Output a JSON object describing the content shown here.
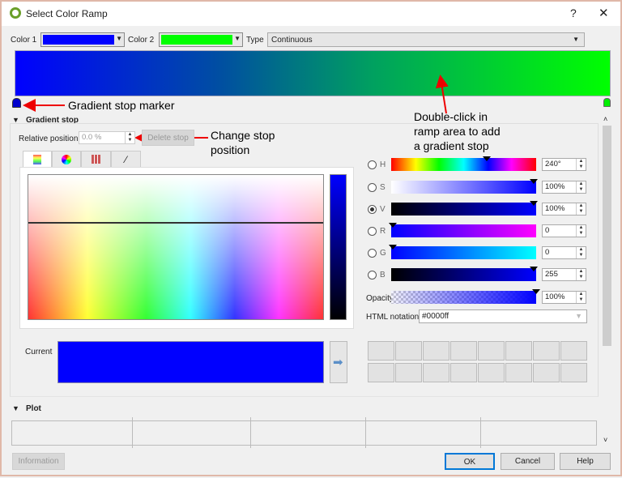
{
  "window": {
    "title": "Select Color Ramp",
    "help_label": "?",
    "close_label": "✕",
    "icon": "qgis-logo-icon"
  },
  "top_row": {
    "color1_label": "Color 1",
    "color1": "#0000ff",
    "color2_label": "Color 2",
    "color2": "#00ff00",
    "type_label": "Type",
    "type_value": "Continuous"
  },
  "ramp": {
    "start_color": "#0000ff",
    "end_color": "#00ff00"
  },
  "annotations": {
    "stop_marker": "Gradient stop marker",
    "double_click": [
      "Double-click in",
      "ramp area to add",
      "a gradient stop"
    ],
    "change_position": [
      "Change stop",
      "position"
    ]
  },
  "gradient_stop": {
    "section_label": "Gradient stop",
    "relative_position_label": "Relative position",
    "relative_position_value": "0.0 %",
    "delete_stop_label": "Delete stop",
    "tabs": [
      "color-ramp-icon",
      "color-wheel-icon",
      "swatches-icon",
      "eyedropper-icon"
    ]
  },
  "components": [
    {
      "label": "H",
      "value": "240°",
      "level": 0.667,
      "checked": false
    },
    {
      "label": "S",
      "value": "100%",
      "level": 1.0,
      "checked": false
    },
    {
      "label": "V",
      "value": "100%",
      "level": 1.0,
      "checked": true
    },
    {
      "label": "R",
      "value": "0",
      "level": 0.0,
      "checked": false
    },
    {
      "label": "G",
      "value": "0",
      "level": 0.0,
      "checked": false
    },
    {
      "label": "B",
      "value": "255",
      "level": 1.0,
      "checked": false
    }
  ],
  "opacity": {
    "label": "Opacity",
    "value": "100%",
    "level": 1.0
  },
  "html_notation": {
    "label": "HTML notation",
    "value": "#0000ff"
  },
  "current": {
    "label": "Current",
    "color": "#0000ff"
  },
  "plot": {
    "section_label": "Plot"
  },
  "buttons": {
    "information": "Information",
    "ok": "OK",
    "cancel": "Cancel",
    "help": "Help"
  }
}
